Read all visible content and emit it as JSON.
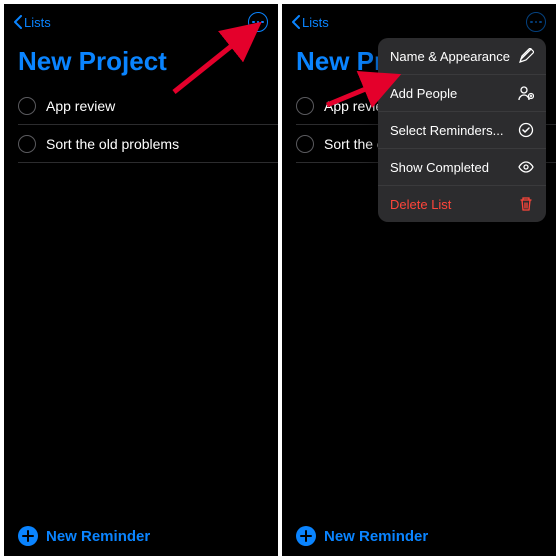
{
  "colors": {
    "accent": "#0a84ff",
    "destructive": "#ff453a",
    "background": "#000000",
    "menu_bg": "#2c2c2e"
  },
  "left": {
    "back_label": "Lists",
    "title": "New Project",
    "items": [
      {
        "label": "App review"
      },
      {
        "label": "Sort the old problems"
      }
    ],
    "new_reminder_label": "New Reminder"
  },
  "right": {
    "back_label": "Lists",
    "title": "New Proj",
    "items": [
      {
        "label": "App review"
      },
      {
        "label": "Sort the old p"
      }
    ],
    "new_reminder_label": "New Reminder",
    "menu": [
      {
        "label": "Name & Appearance",
        "icon": "pencil-icon"
      },
      {
        "label": "Add People",
        "icon": "person-add-icon"
      },
      {
        "label": "Select Reminders...",
        "icon": "check-circle-icon"
      },
      {
        "label": "Show Completed",
        "icon": "eye-icon"
      },
      {
        "label": "Delete List",
        "icon": "trash-icon",
        "destructive": true
      }
    ]
  }
}
